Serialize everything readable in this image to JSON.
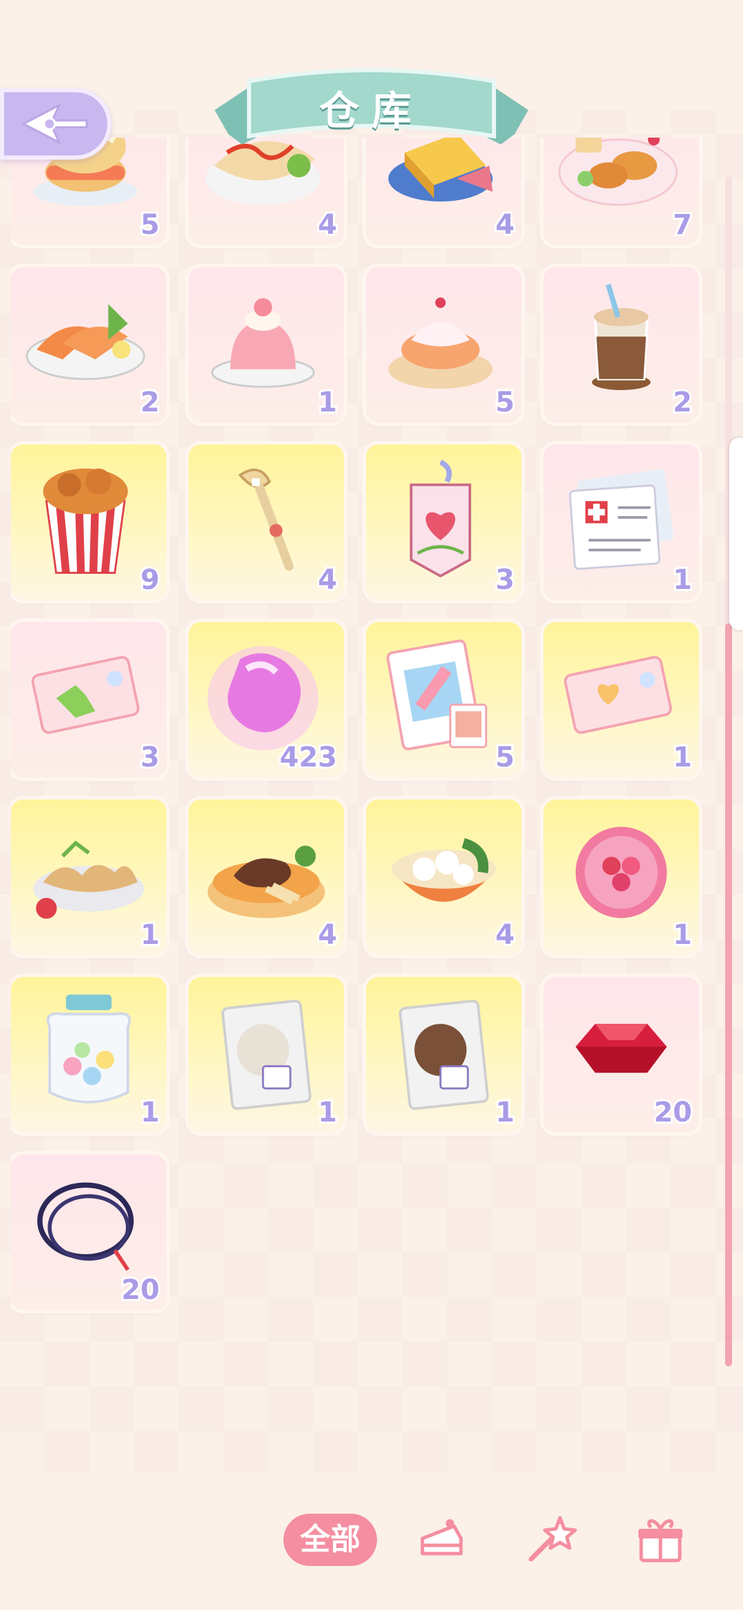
{
  "header": {
    "title": "仓库"
  },
  "colors": {
    "accent": "#f48ea0",
    "count": "#a99be6",
    "banner": "#9fd3c8",
    "back": "#c9b8ef"
  },
  "items": [
    {
      "icon": "burger-icon",
      "count": "5",
      "bg": "pink"
    },
    {
      "icon": "omelette-icon",
      "count": "4",
      "bg": "pink"
    },
    {
      "icon": "toast-icon",
      "count": "4",
      "bg": "pink"
    },
    {
      "icon": "fried-chicken-plate-icon",
      "count": "7",
      "bg": "pink"
    },
    {
      "icon": "salmon-sashimi-icon",
      "count": "2",
      "bg": "pink"
    },
    {
      "icon": "strawberry-pudding-icon",
      "count": "1",
      "bg": "pink"
    },
    {
      "icon": "cream-puff-icon",
      "count": "5",
      "bg": "pink"
    },
    {
      "icon": "iced-coffee-icon",
      "count": "2",
      "bg": "pink"
    },
    {
      "icon": "popcorn-chicken-bucket-icon",
      "count": "9",
      "bg": "yellow"
    },
    {
      "icon": "key-staff-icon",
      "count": "4",
      "bg": "yellow"
    },
    {
      "icon": "heart-charm-tag-icon",
      "count": "3",
      "bg": "yellow"
    },
    {
      "icon": "medical-documents-icon",
      "count": "1",
      "bg": "pink"
    },
    {
      "icon": "puzzle-ticket-icon",
      "count": "3",
      "bg": "pink"
    },
    {
      "icon": "pink-crystal-icon",
      "count": "423",
      "bg": "yellow"
    },
    {
      "icon": "photo-pack-icon",
      "count": "5",
      "bg": "yellow"
    },
    {
      "icon": "heart-ticket-icon",
      "count": "1",
      "bg": "yellow"
    },
    {
      "icon": "fried-dumplings-icon",
      "count": "1",
      "bg": "yellow"
    },
    {
      "icon": "steak-plate-icon",
      "count": "4",
      "bg": "yellow"
    },
    {
      "icon": "fishball-soup-icon",
      "count": "4",
      "bg": "yellow"
    },
    {
      "icon": "pink-badge-icon",
      "count": "1",
      "bg": "yellow"
    },
    {
      "icon": "candy-jar-icon",
      "count": "1",
      "bg": "yellow"
    },
    {
      "icon": "white-powder-bag-icon",
      "count": "1",
      "bg": "yellow"
    },
    {
      "icon": "brown-powder-bag-icon",
      "count": "1",
      "bg": "yellow"
    },
    {
      "icon": "red-gem-icon",
      "count": "20",
      "bg": "pink"
    },
    {
      "icon": "cord-loop-icon",
      "count": "20",
      "bg": "pink"
    }
  ],
  "tabs": {
    "all_label": "全部",
    "icons": [
      "cake-icon",
      "wand-icon",
      "gift-box-icon"
    ]
  }
}
